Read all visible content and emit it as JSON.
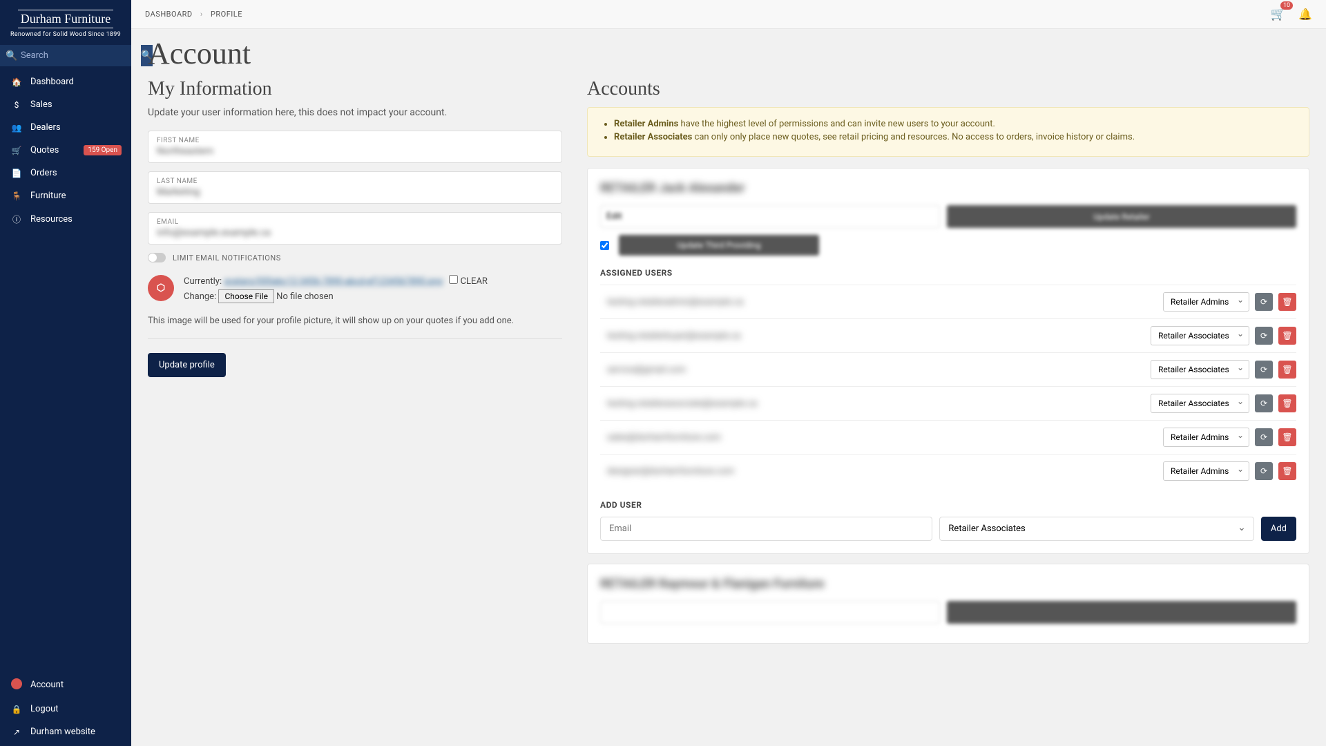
{
  "brand": {
    "name": "Durham Furniture",
    "tagline": "Renowned for Solid Wood Since 1899"
  },
  "search": {
    "placeholder": "Search"
  },
  "nav": {
    "dashboard": "Dashboard",
    "sales": "Sales",
    "dealers": "Dealers",
    "quotes": "Quotes",
    "quotes_badge": "159 Open",
    "orders": "Orders",
    "furniture": "Furniture",
    "resources": "Resources"
  },
  "bottom_nav": {
    "account": "Account",
    "logout": "Logout",
    "website": "Durham website"
  },
  "breadcrumb": {
    "a": "DASHBOARD",
    "b": "PROFILE"
  },
  "cart_count": "10",
  "page_title": "Account",
  "left": {
    "heading": "My Information",
    "subtext": "Update your user information here, this does not impact your account.",
    "first_name_label": "FIRST NAME",
    "first_name_value": "Northeastern",
    "last_name_label": "LAST NAME",
    "last_name_value": "Marketing",
    "email_label": "EMAIL",
    "email_value": "info@example.example.ca",
    "toggle_label": "LIMIT EMAIL NOTIFICATIONS",
    "currently_label": "Currently:",
    "currently_value": "avatars/000abc12-3456-7890-abcd-ef1234567890.png",
    "clear_label": "CLEAR",
    "change_label": "Change:",
    "choose_file": "Choose File",
    "no_file": "No file chosen",
    "help": "This image will be used for your profile picture, it will show up on your quotes if you add one.",
    "submit": "Update profile"
  },
  "right": {
    "heading": "Accounts",
    "notice_admin_term": "Retailer Admins",
    "notice_admin_text": " have the highest level of permissions and can invite new users to your account.",
    "notice_assoc_term": "Retailer Associates",
    "notice_assoc_text": " can only only place new quotes, see retail pricing and resources. No access to orders, invoice history or claims.",
    "card1_title": "RETAILER Jack Alexander",
    "card1_input": "Edit",
    "card1_btn1": "Update Retailer",
    "card1_btn2": "Update Third Providing",
    "assigned_label": "ASSIGNED USERS",
    "users": [
      {
        "email": "testing.retaileradmin@example.ca",
        "role": "Retailer Admins"
      },
      {
        "email": "testing.retailerbuyer@example.ca",
        "role": "Retailer Associates"
      },
      {
        "email": "service@gmail.com",
        "role": "Retailer Associates"
      },
      {
        "email": "testing.retailerassociate@example.ca",
        "role": "Retailer Associates"
      },
      {
        "email": "sales@durhamfurniture.com",
        "role": "Retailer Admins"
      },
      {
        "email": "designer@durhamfurniture.com",
        "role": "Retailer Admins"
      }
    ],
    "add_user_label": "ADD USER",
    "add_email_placeholder": "Email",
    "add_role": "Retailer Associates",
    "add_btn": "Add",
    "card2_title": "RETAILER Raymour & Flanigan Furniture"
  }
}
